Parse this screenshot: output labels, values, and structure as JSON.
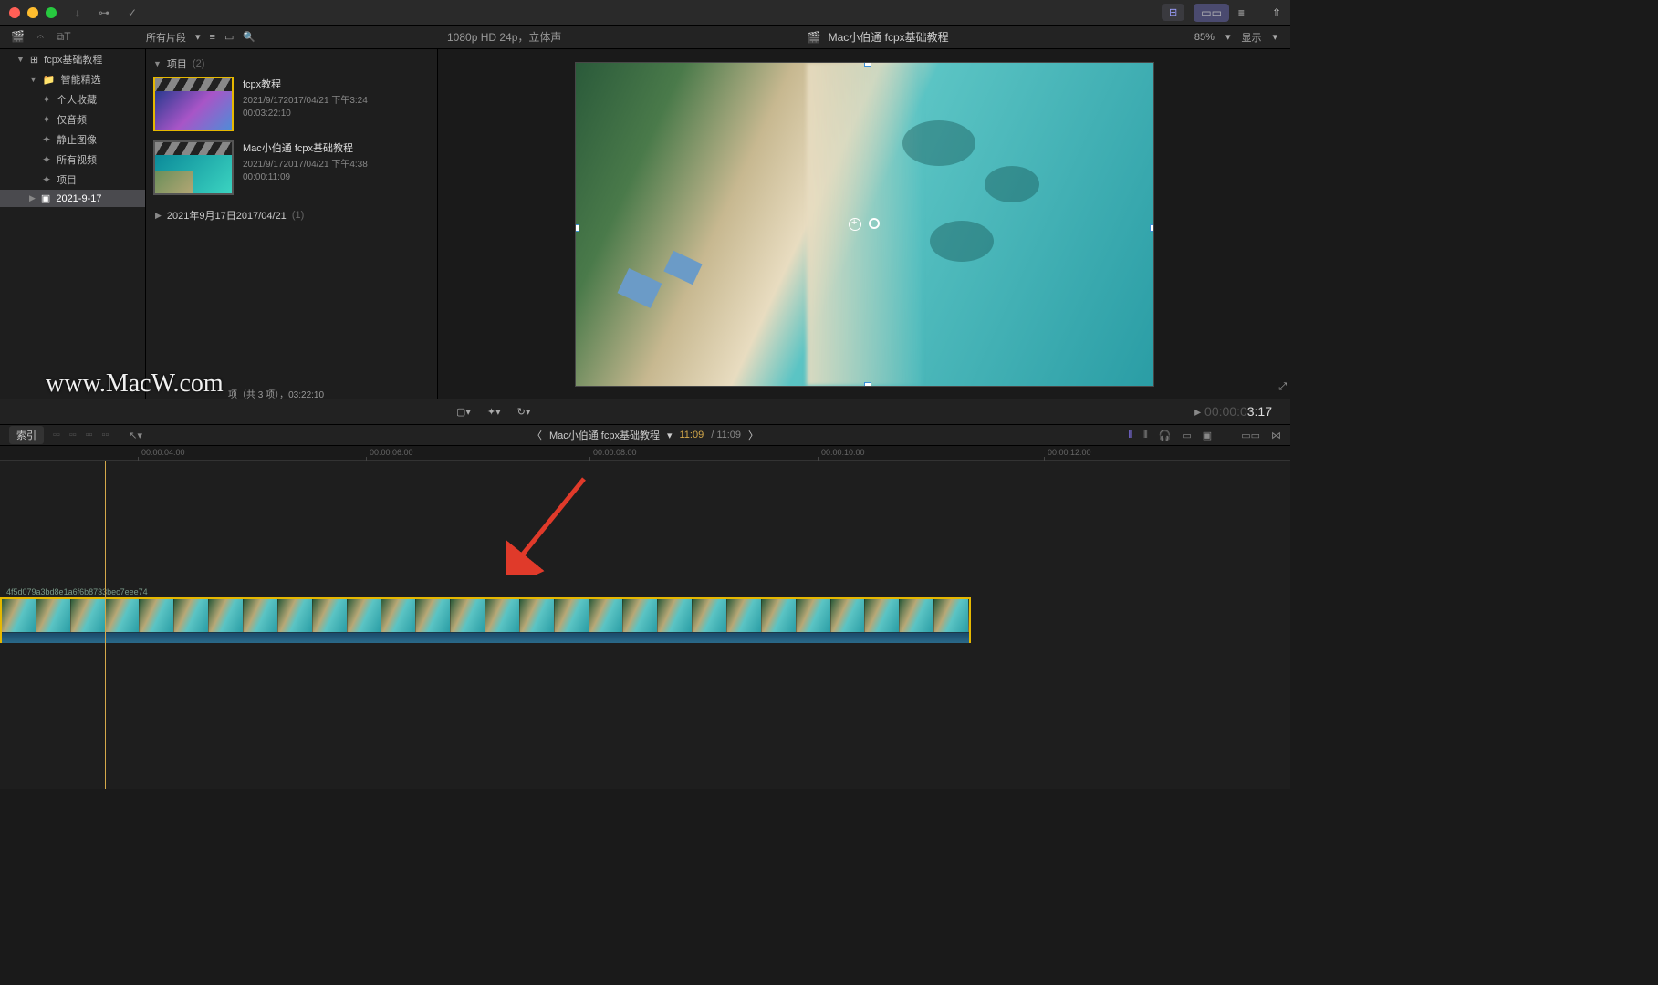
{
  "titlebar": {
    "grid_icon": "⊞",
    "mode_icon": "▭▭",
    "slider_icon": "⚙",
    "share_icon": "⇧"
  },
  "topbar": {
    "media_icon": "🎬",
    "fx_icon": "✦",
    "title_icon": "T",
    "clips_label": "所有片段",
    "format": "1080p HD 24p，立体声",
    "project_icon": "🎬",
    "project_title": "Mac小伯通 fcpx基础教程",
    "zoom": "85%",
    "display_label": "显示"
  },
  "sidebar": {
    "library": "fcpx基础教程",
    "smart": "智能精选",
    "items": [
      {
        "icon": "✦",
        "label": "个人收藏"
      },
      {
        "icon": "✦",
        "label": "仅音频"
      },
      {
        "icon": "✦",
        "label": "静止图像"
      },
      {
        "icon": "✦",
        "label": "所有视频"
      },
      {
        "icon": "✦",
        "label": "项目"
      }
    ],
    "event_icon": "▣",
    "event": "2021-9-17"
  },
  "browser": {
    "section_label": "项目",
    "section_count": "(2)",
    "clips": [
      {
        "name": "fcpx教程",
        "date": "2021/9/172017/04/21 下午3:24",
        "duration": "00:03:22:10"
      },
      {
        "name": "Mac小伯通 fcpx基础教程",
        "date": "2021/9/172017/04/21 下午4:38",
        "duration": "00:00:11:09"
      }
    ],
    "folder": "2021年9月17日2017/04/21",
    "folder_count": "(1)"
  },
  "viewer": {
    "timecode_prefix": "▸ 00:00:0",
    "timecode": "3:17",
    "expand_icon": "⤢"
  },
  "watermark": "www.MacW.com",
  "clip_info_text": "项（共 3 项），03:22:10",
  "timeline_hdr": {
    "index": "索引",
    "nav_prev": "〈",
    "title": "Mac小伯通 fcpx基础教程",
    "time": "11:09",
    "duration": "/ 11:09",
    "nav_next": "〉"
  },
  "ruler": {
    "ticks": [
      {
        "pos": 155,
        "label": "00:00:04:00"
      },
      {
        "pos": 405,
        "label": "00:00:06:00"
      },
      {
        "pos": 650,
        "label": "00:00:08:00"
      },
      {
        "pos": 900,
        "label": "00:00:10:00"
      },
      {
        "pos": 1148,
        "label": "00:00:12:00"
      }
    ]
  },
  "clip_track": {
    "label": "4f5d079a3bd8e1a6f6b8733bec7eee74"
  }
}
